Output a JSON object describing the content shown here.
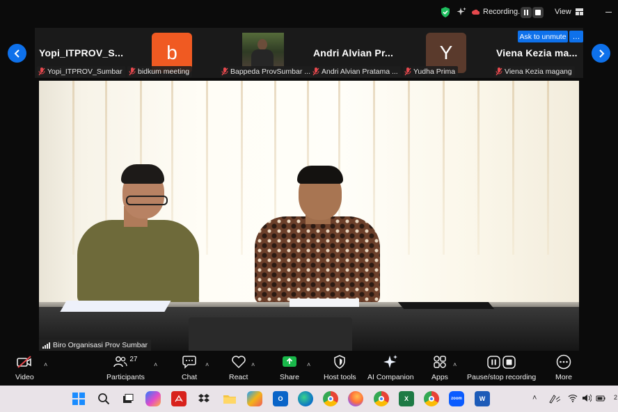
{
  "top_bar": {
    "recording_label": "Recording...",
    "view_label": "View"
  },
  "strip": {
    "tiles": [
      {
        "name": "Yopi_ITPROV_S...",
        "label": "Yopi_ITPROV_Sumbar"
      },
      {
        "avatar_letter": "b",
        "avatar_color": "#f05a22",
        "label": "bidkum meeting"
      },
      {
        "label": "Bappeda ProvSumbar ..."
      },
      {
        "name": "Andri Alvian Pr...",
        "label": "Andri Alvian Pratama ..."
      },
      {
        "avatar_letter": "Y",
        "avatar_color": "#5a3a2c",
        "label": "Yudha Prima"
      },
      {
        "name": "Viena Kezia ma...",
        "label": "Viena Kezia magang"
      }
    ],
    "ask_to_unmute": "Ask to unmute",
    "more": "…"
  },
  "video": {
    "speaker_label": "Biro Organisasi Prov Sumbar"
  },
  "toolbar": {
    "video": "Video",
    "participants": "Participants",
    "participants_count": "27",
    "chat": "Chat",
    "react": "React",
    "share": "Share",
    "host_tools": "Host tools",
    "ai_companion": "AI Companion",
    "apps": "Apps",
    "pause_stop": "Pause/stop recording",
    "more": "More"
  },
  "taskbar": {
    "clock_partial": "2",
    "accent": "#0e71eb"
  }
}
